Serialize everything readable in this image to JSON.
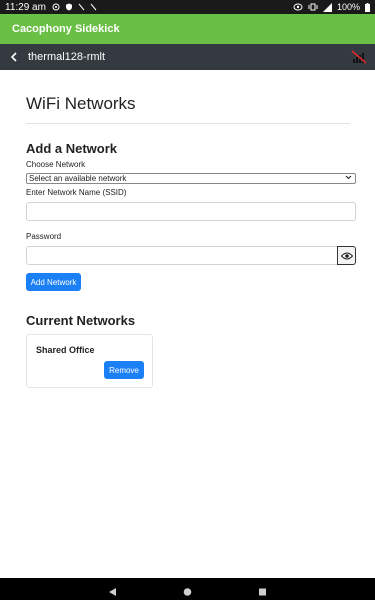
{
  "status": {
    "time": "11:29 am",
    "battery": "100%"
  },
  "app": {
    "title": "Cacophony Sidekick"
  },
  "device": {
    "name": "thermal128-rmlt"
  },
  "page": {
    "title": "WiFi Networks"
  },
  "add_network": {
    "heading": "Add a Network",
    "choose_label": "Choose Network",
    "select_value": "Select an available network",
    "ssid_label": "Enter Network Name (SSID)",
    "ssid_value": "",
    "password_label": "Password",
    "password_value": "",
    "add_button": "Add Network"
  },
  "current_networks": {
    "heading": "Current Networks",
    "items": [
      {
        "name": "Shared Office",
        "remove_label": "Remove"
      }
    ]
  },
  "colors": {
    "appbar": "#6abf45",
    "devicebar": "#343a40",
    "primary_button": "#1b7ff5"
  }
}
